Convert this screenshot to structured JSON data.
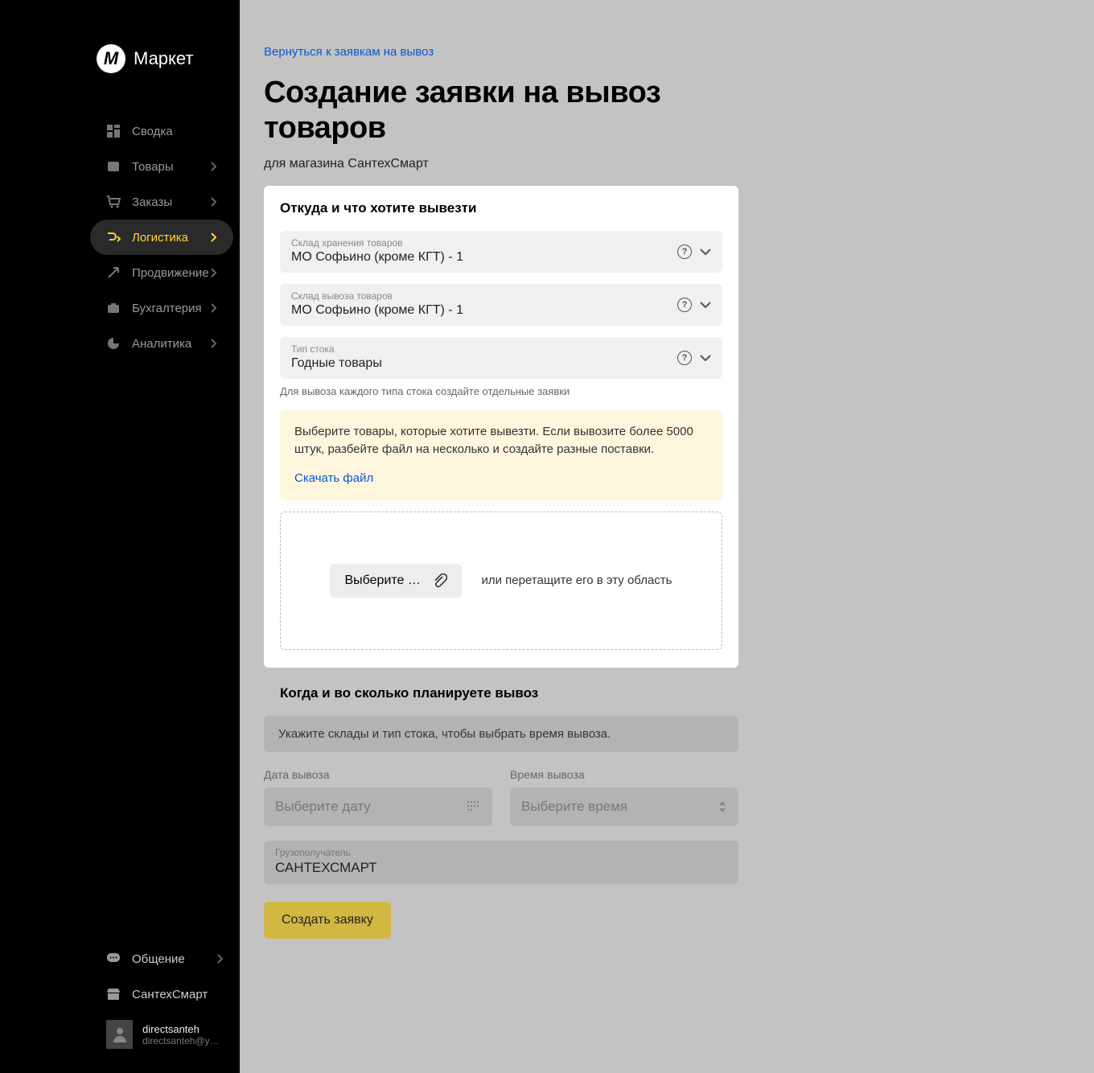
{
  "brand": {
    "name": "Маркет",
    "mark": "M"
  },
  "sidebar": {
    "items": [
      {
        "label": "Сводка"
      },
      {
        "label": "Товары"
      },
      {
        "label": "Заказы"
      },
      {
        "label": "Логистика"
      },
      {
        "label": "Продвижение"
      },
      {
        "label": "Бухгалтерия"
      },
      {
        "label": "Аналитика"
      }
    ],
    "bottom": [
      {
        "label": "Общение"
      },
      {
        "label": "СантехСмарт"
      }
    ]
  },
  "user": {
    "name": "directsanteh",
    "email": "directsanteh@yand…"
  },
  "back_link": "Вернуться к заявкам на вывоз",
  "page_title": "Создание заявки на вывоз товаров",
  "page_subtitle": "для магазина СантехСмарт",
  "section1": {
    "title": "Откуда и что хотите вывезти",
    "storage_label": "Склад хранения товаров",
    "storage_value": "МО Софьино (кроме КГТ) - 1",
    "pickup_label": "Склад вывоза товаров",
    "pickup_value": "МО Софьино (кроме КГТ) - 1",
    "stock_type_label": "Тип стока",
    "stock_type_value": "Годные товары",
    "stock_hint": "Для вывоза каждого типа стока создайте отдельные заявки",
    "info_text": "Выберите товары, которые хотите вывезти. Если вывозите более 5000 штук, разбейте файл на несколько и создайте разные поставки.",
    "info_link": "Скачать файл",
    "file_btn": "Выберите фа…",
    "drop_text": "или перетащите его в эту область"
  },
  "section2": {
    "title": "Когда и во сколько планируете вывоз",
    "notice": "Укажите склады и тип стока, чтобы выбрать время вывоза.",
    "date_label": "Дата вывоза",
    "date_placeholder": "Выберите дату",
    "time_label": "Время вывоза",
    "time_placeholder": "Выберите время",
    "consignee_label": "Грузополучатель",
    "consignee_value": "САНТЕХСМАРТ",
    "submit": "Создать заявку"
  }
}
